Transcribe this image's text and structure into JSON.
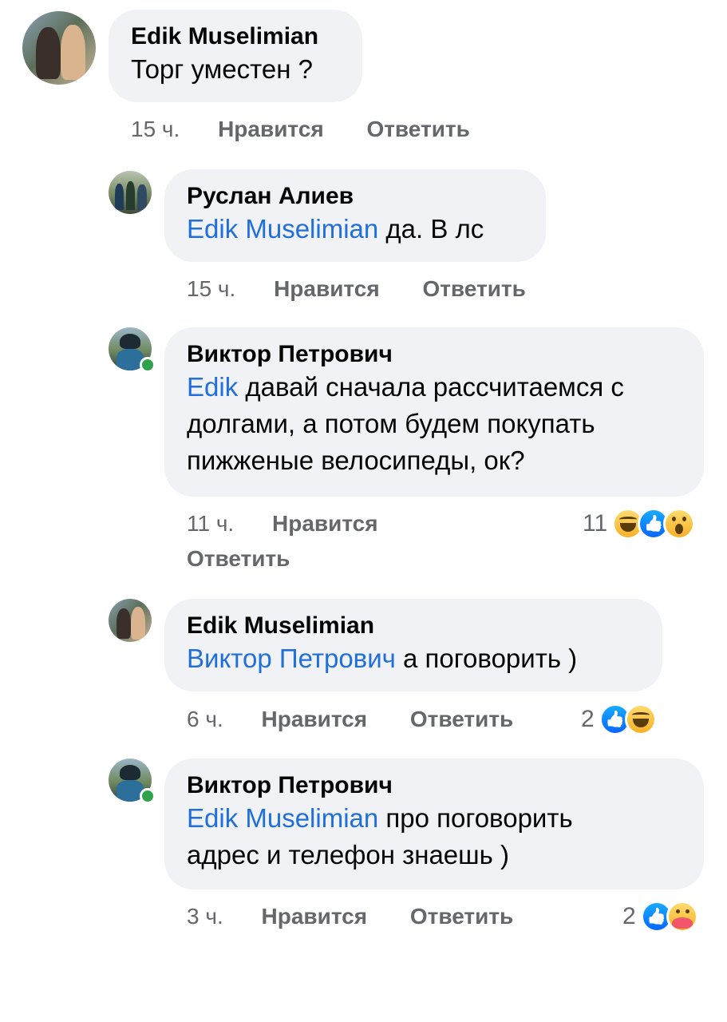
{
  "comments": [
    {
      "author": "Edik Muselimian",
      "mention": "",
      "text": "Торг уместен ?",
      "time": "15 ч.",
      "like_label": "Нравится",
      "reply_label": "Ответить",
      "reactions_count": "",
      "reactions": []
    },
    {
      "author": "Руслан Алиев",
      "mention": "Edik Muselimian",
      "text": " да. В лс",
      "time": "15 ч.",
      "like_label": "Нравится",
      "reply_label": "Ответить",
      "reactions_count": "",
      "reactions": []
    },
    {
      "author": "Виктор Петрович",
      "mention": "Edik",
      "text_lines": [
        " давай сначала рассчитаемся с",
        "долгами, а потом будем покупать",
        "пижженые велосипеды, ок?"
      ],
      "time": "11 ч.",
      "like_label": "Нравится",
      "reply_label": "Ответить",
      "reactions_count": "11",
      "reactions": [
        "haha",
        "like",
        "wow"
      ],
      "online": true
    },
    {
      "author": "Edik Muselimian",
      "mention": "Виктор Петрович",
      "text": " а поговорить )",
      "time": "6 ч.",
      "like_label": "Нравится",
      "reply_label": "Ответить",
      "reactions_count": "2",
      "reactions": [
        "like",
        "haha"
      ]
    },
    {
      "author": "Виктор Петрович",
      "mention": "Edik Muselimian",
      "text_lines": [
        " про поговорить",
        "адрес и телефон знаешь )"
      ],
      "time": "3 ч.",
      "like_label": "Нравится",
      "reply_label": "Ответить",
      "reactions_count": "2",
      "reactions": [
        "like",
        "care"
      ],
      "online": true
    }
  ],
  "colors": {
    "bubble": "#f0f2f5",
    "mention": "#216fdb",
    "meta": "#65676b",
    "online": "#31a24c"
  }
}
